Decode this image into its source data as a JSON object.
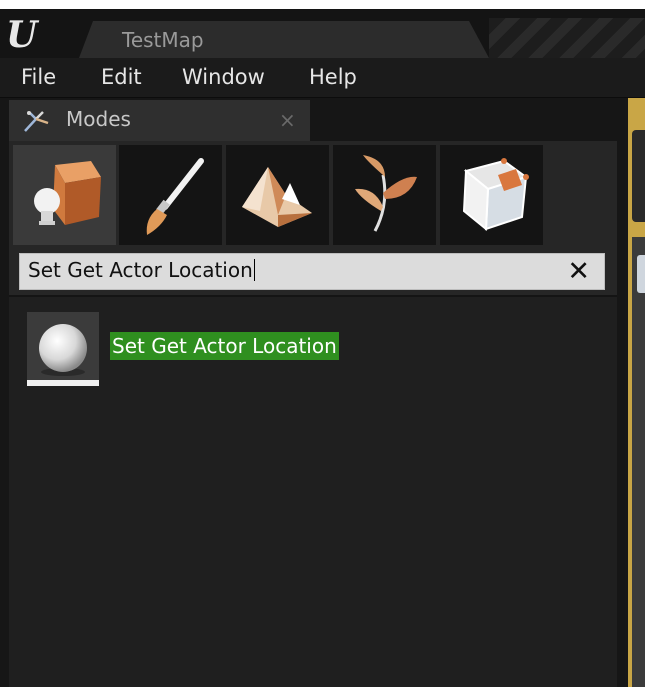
{
  "title_bar": {
    "logo": "U",
    "document_tab": "TestMap"
  },
  "menu": {
    "items": [
      "File",
      "Edit",
      "Window",
      "Help"
    ]
  },
  "panel": {
    "tab_label": "Modes",
    "tab_close": "×",
    "mode_tabs": [
      {
        "name": "place",
        "icon": "place-mode-icon"
      },
      {
        "name": "paint",
        "icon": "paint-brush-icon"
      },
      {
        "name": "landscape",
        "icon": "landscape-mountain-icon"
      },
      {
        "name": "foliage",
        "icon": "foliage-leaf-icon"
      },
      {
        "name": "geometry",
        "icon": "geometry-cube-icon"
      }
    ],
    "active_mode": "place"
  },
  "search": {
    "value": "Set Get Actor Location",
    "clear_label": "✕"
  },
  "results": [
    {
      "label": "Set Get Actor Location",
      "icon": "sphere-actor-icon"
    }
  ],
  "colors": {
    "highlight": "#2f8f1f",
    "accent_gold": "#c9a646"
  }
}
